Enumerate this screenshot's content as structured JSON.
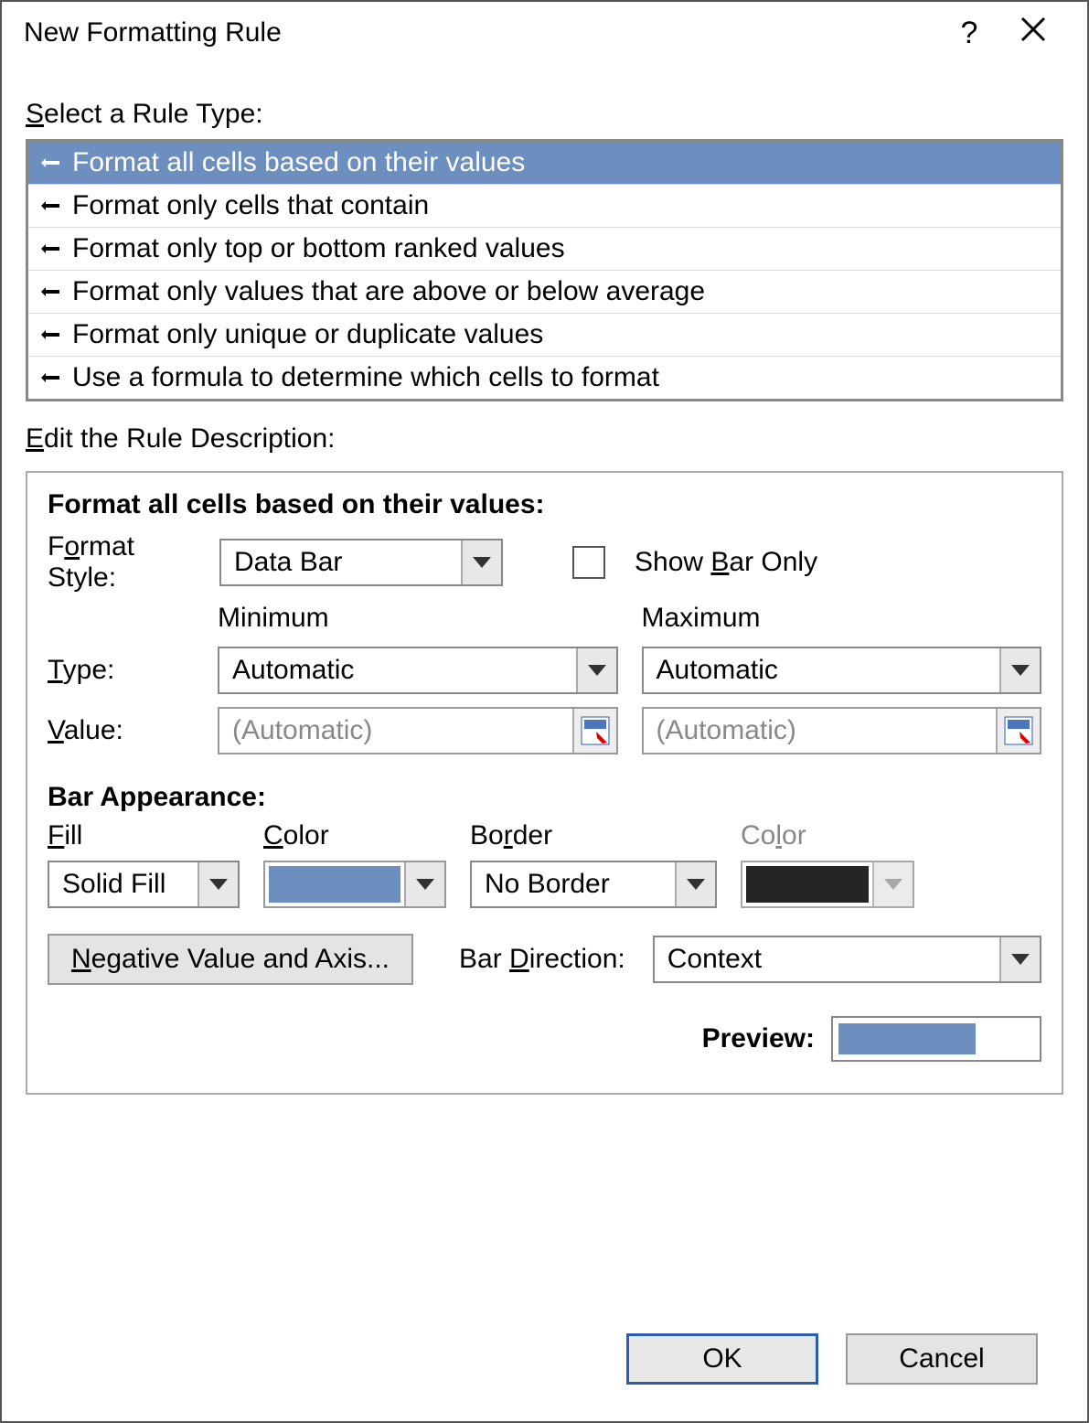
{
  "title": "New Formatting Rule",
  "help_symbol": "?",
  "section_select": "Select a Rule Type:",
  "rule_types": [
    "Format all cells based on their values",
    "Format only cells that contain",
    "Format only top or bottom ranked values",
    "Format only values that are above or below average",
    "Format only unique or duplicate values",
    "Use a formula to determine which cells to format"
  ],
  "section_edit": "Edit the Rule Description:",
  "panel_title": "Format all cells based on their values:",
  "format_style_label": "Format Style:",
  "format_style_value": "Data Bar",
  "show_bar_only": "Show Bar Only",
  "min_label": "Minimum",
  "max_label": "Maximum",
  "type_label": "Type:",
  "value_label": "Value:",
  "type_min": "Automatic",
  "type_max": "Automatic",
  "value_min": "(Automatic)",
  "value_max": "(Automatic)",
  "bar_appearance": "Bar Appearance:",
  "fill_label": "Fill",
  "color_label": "Color",
  "border_label": "Border",
  "color2_label": "Color",
  "fill_value": "Solid Fill",
  "border_value": "No Border",
  "fill_color": "#6d8fc0",
  "border_color": "#000000",
  "neg_btn": "Negative Value and Axis...",
  "bar_dir_label": "Bar Direction:",
  "bar_dir_value": "Context",
  "preview_label": "Preview:",
  "ok": "OK",
  "cancel": "Cancel"
}
